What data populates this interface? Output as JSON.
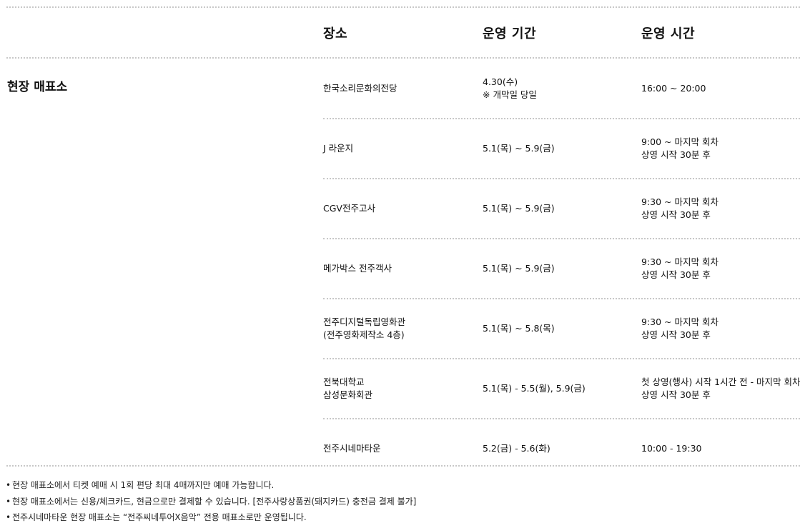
{
  "table": {
    "headers": {
      "place": "장소",
      "period": "운영 기간",
      "time": "운영 시간"
    },
    "section_title": "현장 매표소",
    "rows": [
      {
        "place": [
          "한국소리문화의전당"
        ],
        "period": [
          "4.30(수)",
          "※ 개막일 당일"
        ],
        "time": [
          "16:00 ~ 20:00"
        ]
      },
      {
        "place": [
          "J 라운지"
        ],
        "period": [
          "5.1(목) ~ 5.9(금)"
        ],
        "time": [
          "9:00 ~ 마지막 회차",
          "상영 시작 30분 후"
        ]
      },
      {
        "place": [
          "CGV전주고사"
        ],
        "period": [
          "5.1(목) ~ 5.9(금)"
        ],
        "time": [
          "9:30 ~ 마지막 회차",
          "상영 시작 30분 후"
        ]
      },
      {
        "place": [
          "메가박스 전주객사"
        ],
        "period": [
          "5.1(목) ~ 5.9(금)"
        ],
        "time": [
          "9:30 ~ 마지막 회차",
          "상영 시작 30분 후"
        ]
      },
      {
        "place": [
          "전주디지털독립영화관",
          "(전주영화제작소 4층)"
        ],
        "period": [
          "5.1(목) ~ 5.8(목)"
        ],
        "time": [
          "9:30 ~ 마지막 회차",
          "상영 시작 30분 후"
        ]
      },
      {
        "place": [
          "전북대학교",
          "삼성문화회관"
        ],
        "period": [
          "5.1(목) - 5.5(월), 5.9(금)"
        ],
        "time": [
          "첫 상영(행사) 시작 1시간 전 - 마지막 회차",
          "상영 시작 30분 후"
        ]
      },
      {
        "place": [
          "전주시네마타운"
        ],
        "period": [
          "5.2(금) - 5.6(화)"
        ],
        "time": [
          "10:00 - 19:30"
        ]
      }
    ]
  },
  "notes": {
    "bullet": "•",
    "items": [
      "현장 매표소에서 티켓 예매 시 1회 편당 최대 4매까지만 예매 가능합니다.",
      "현장 매표소에서는 신용/체크카드, 현금으로만 결제할 수 있습니다. [전주사랑상품권(돼지카드) 충전금 결제 불가]",
      "전주시네마타운 현장 매표소는 “전주씨네투어X음악” 전용 매표소로만 운영됩니다."
    ]
  }
}
